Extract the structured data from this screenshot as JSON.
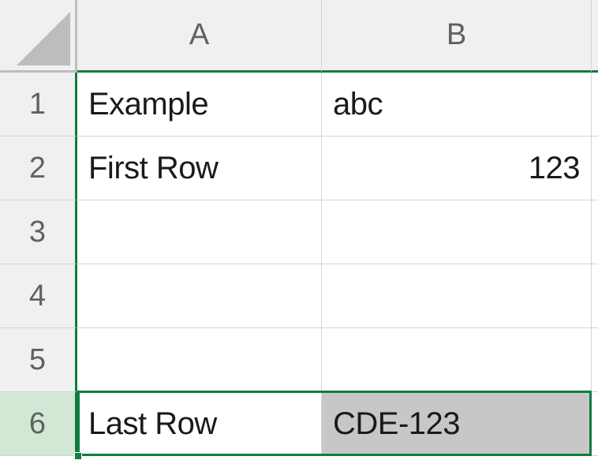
{
  "columns": [
    "A",
    "B"
  ],
  "rows": [
    "1",
    "2",
    "3",
    "4",
    "5",
    "6"
  ],
  "cells": {
    "A1": {
      "value": "Example",
      "align": "left"
    },
    "B1": {
      "value": "abc",
      "align": "left"
    },
    "A2": {
      "value": "First Row",
      "align": "left"
    },
    "B2": {
      "value": "123",
      "align": "right"
    },
    "A3": {
      "value": "",
      "align": "left"
    },
    "B3": {
      "value": "",
      "align": "left"
    },
    "A4": {
      "value": "",
      "align": "left"
    },
    "B4": {
      "value": "",
      "align": "left"
    },
    "A5": {
      "value": "",
      "align": "left"
    },
    "B5": {
      "value": "",
      "align": "left"
    },
    "A6": {
      "value": "Last Row",
      "align": "left"
    },
    "B6": {
      "value": "CDE-123",
      "align": "left"
    }
  },
  "selected_row": "6",
  "selected_cell": "B6",
  "colors": {
    "excel_green": "#107c41",
    "header_bg": "#f0f0f0",
    "selected_row_bg": "#d2e8d4",
    "selected_cell_bg": "#c7c7c7"
  }
}
